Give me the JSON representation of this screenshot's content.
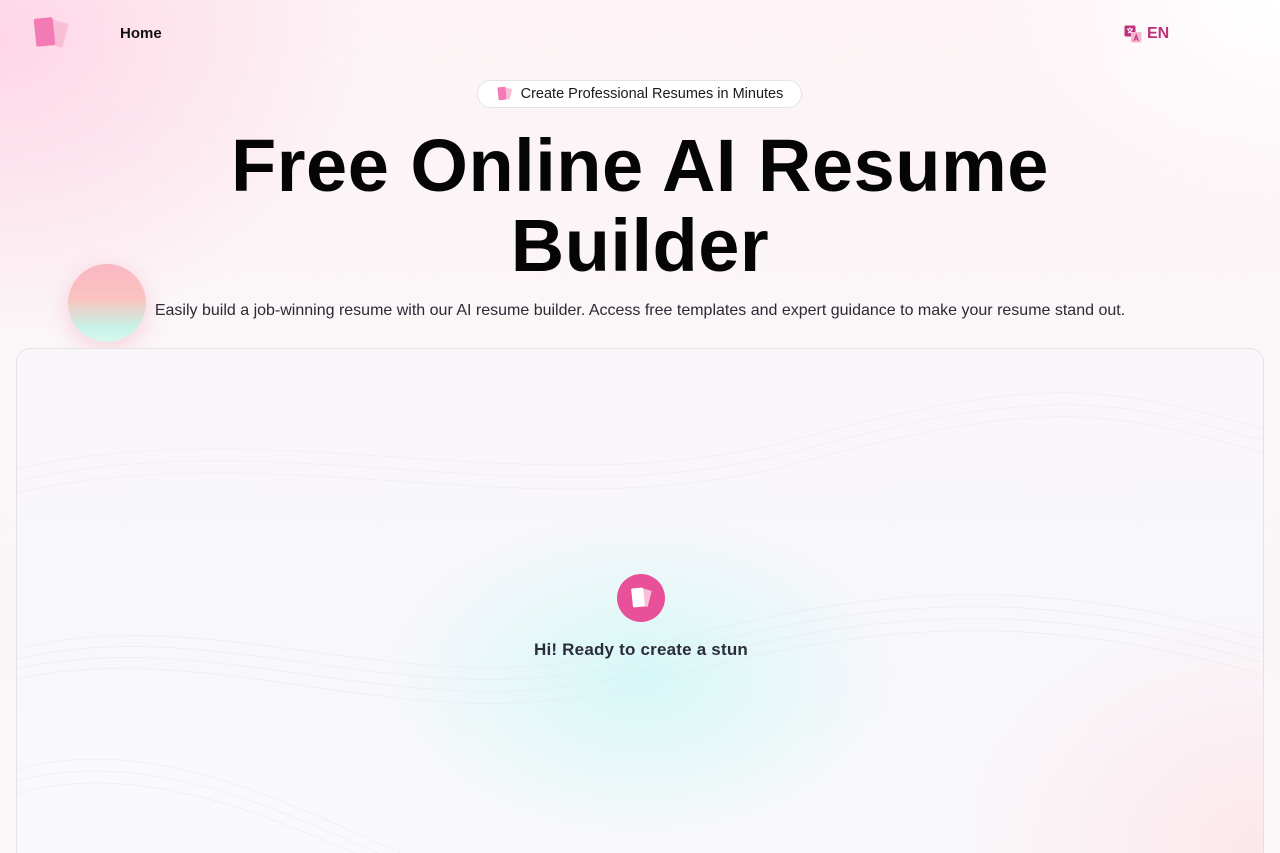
{
  "header": {
    "logo_icon": "resume-pages-logo-icon",
    "nav_home_label": "Home",
    "language_icon": "translate-icon",
    "language_label": "EN"
  },
  "hero": {
    "badge_icon": "resume-pages-icon",
    "badge_text": "Create Professional Resumes in Minutes",
    "title_line1": "Free Online AI Resume",
    "title_line2": "Builder",
    "subtitle": "Easily build a job-winning resume with our AI resume builder. Access free templates and expert guidance to make your resume stand out."
  },
  "panel": {
    "assistant_icon": "resume-assistant-avatar-icon",
    "greeting": "Hi! Ready to create a stun"
  },
  "colors": {
    "accent": "#e8509a",
    "language": "#c0307a",
    "logo_front": "#f176b3",
    "logo_back": "#f9b9d3"
  }
}
